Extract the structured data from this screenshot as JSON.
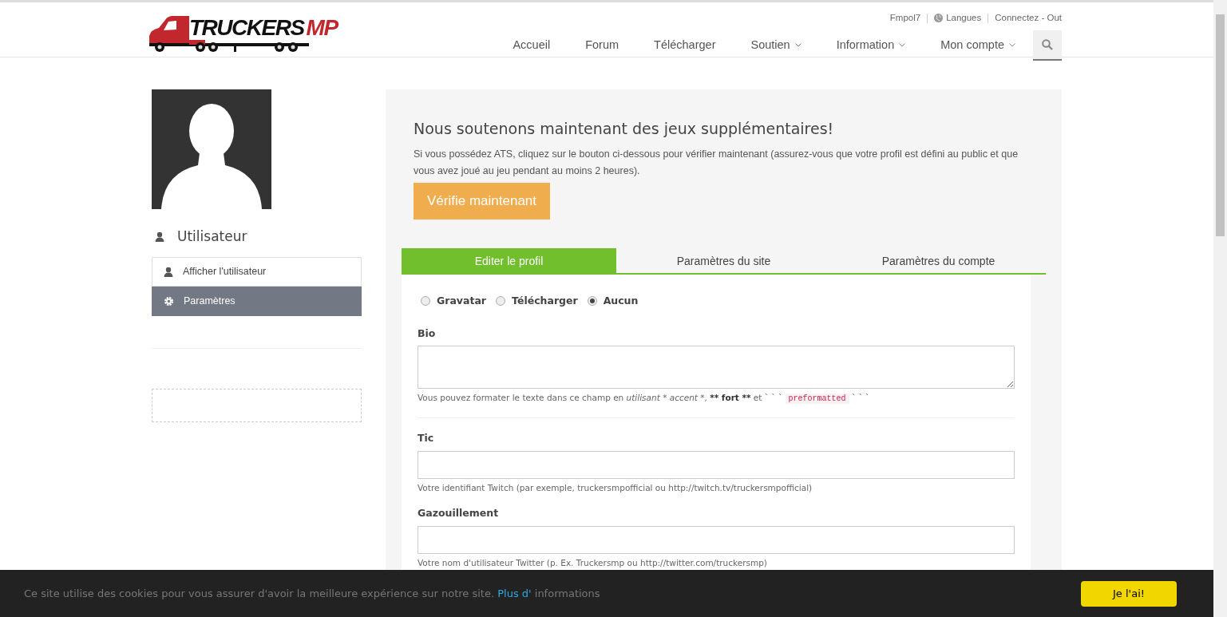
{
  "header": {
    "logo": {
      "word_1": "TRUCKERS",
      "word_2": "MP"
    },
    "top_links": [
      {
        "label": "Fmpol7",
        "kind": "user"
      },
      {
        "label": "Langues",
        "kind": "language"
      },
      {
        "label": "Connectez - Out",
        "kind": "logout"
      }
    ],
    "nav": [
      {
        "label": "Accueil",
        "dropdown": false
      },
      {
        "label": "Forum",
        "dropdown": false
      },
      {
        "label": "Télécharger",
        "dropdown": false
      },
      {
        "label": "Soutien",
        "dropdown": true
      },
      {
        "label": "Information",
        "dropdown": true
      },
      {
        "label": "Mon compte",
        "dropdown": true
      }
    ]
  },
  "sidebar": {
    "heading": "Utilisateur",
    "items": [
      {
        "label": "Afficher l'utilisateur",
        "selected": false
      },
      {
        "label": "Paramètres",
        "selected": true
      }
    ]
  },
  "notice": {
    "title": "Nous soutenons maintenant des jeux supplémentaires!",
    "text": "Si vous possédez ATS, cliquez sur le bouton ci-dessous pour vérifier maintenant (assurez-vous que votre profil est défini au public et que vous avez joué au jeu pendant au moins 2 heures).",
    "button": "Vérifie maintenant"
  },
  "tabs": [
    {
      "label": "Editer le profil",
      "selected": true
    },
    {
      "label": "Paramètres du site",
      "selected": false
    },
    {
      "label": "Paramètres du compte",
      "selected": false
    }
  ],
  "avatar_options": [
    {
      "label": "Gravatar",
      "selected": false
    },
    {
      "label": "Télécharger",
      "selected": false
    },
    {
      "label": "Aucun",
      "selected": true
    }
  ],
  "fields": [
    {
      "label": "Bio",
      "kind": "textarea",
      "help": [
        {
          "kind": "plain",
          "text": "Vous pouvez formater le texte dans ce champ en "
        },
        {
          "kind": "italic",
          "text": "utilisant * accent *"
        },
        {
          "kind": "plain",
          "text": ", "
        },
        {
          "kind": "bold",
          "text": "** fort **"
        },
        {
          "kind": "plain",
          "text": " et ` ` ` "
        },
        {
          "kind": "code",
          "text": "preformatted"
        },
        {
          "kind": "plain",
          "text": " ` ` `"
        }
      ],
      "divider": true
    },
    {
      "label": "Tic",
      "kind": "input",
      "help": [
        {
          "kind": "plain",
          "text": "Votre identifiant Twitch (par exemple, truckersmpofficial ou http://twitch.tv/truckersmpofficial)"
        }
      ],
      "divider": false
    },
    {
      "label": "Gazouillement",
      "kind": "input",
      "help": [
        {
          "kind": "plain",
          "text": "Votre nom d'utilisateur Twitter (p. Ex. Truckersmp ou http://twitter.com/truckersmp)"
        }
      ],
      "divider": false
    }
  ],
  "cookie_bar": {
    "text": "Ce site utilise des cookies pour vous assurer d'avoir la meilleure expérience sur notre site.",
    "link": "Plus d'",
    "text_after": "informations",
    "button": "Je l'ai!"
  }
}
